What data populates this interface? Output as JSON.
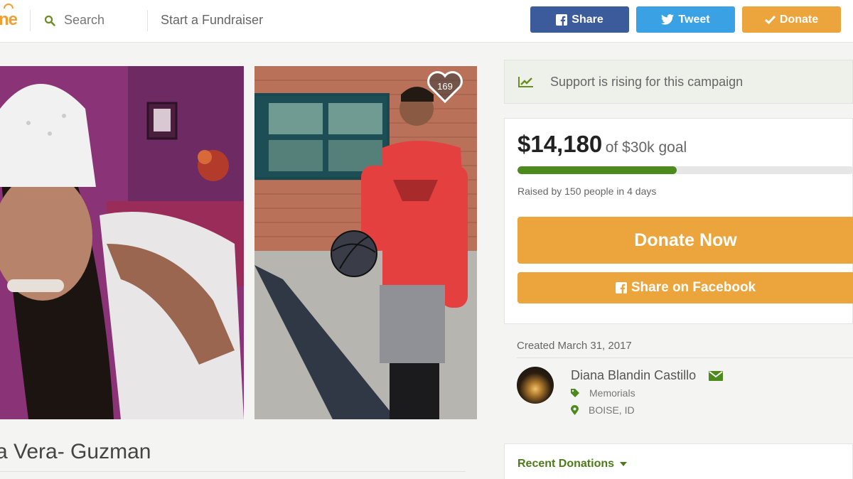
{
  "header": {
    "logo_text": "ne",
    "search_label": "Search",
    "start_label": "Start a Fundraiser",
    "share_label": "Share",
    "tweet_label": "Tweet",
    "donate_label": "Donate"
  },
  "photos": {
    "heart_count": "169"
  },
  "campaign": {
    "title": "a Vera- Guzman"
  },
  "trend": {
    "text": "Support is rising for this campaign"
  },
  "funding": {
    "amount": "$14,180",
    "goal_text": "of $30k goal",
    "progress_fraction": 0.4727,
    "raised_by": "Raised by 150 people in 4 days",
    "donate_now_label": "Donate Now",
    "share_fb_label": "Share on Facebook"
  },
  "organizer": {
    "created": "Created March 31, 2017",
    "name": "Diana Blandin Castillo",
    "category": "Memorials",
    "location": "BOISE, ID"
  },
  "recent": {
    "label": "Recent Donations"
  },
  "colors": {
    "facebook": "#3b5b9a",
    "twitter": "#3aa1e4",
    "accent_orange": "#eba53c",
    "progress_green": "#4d8a1e"
  }
}
